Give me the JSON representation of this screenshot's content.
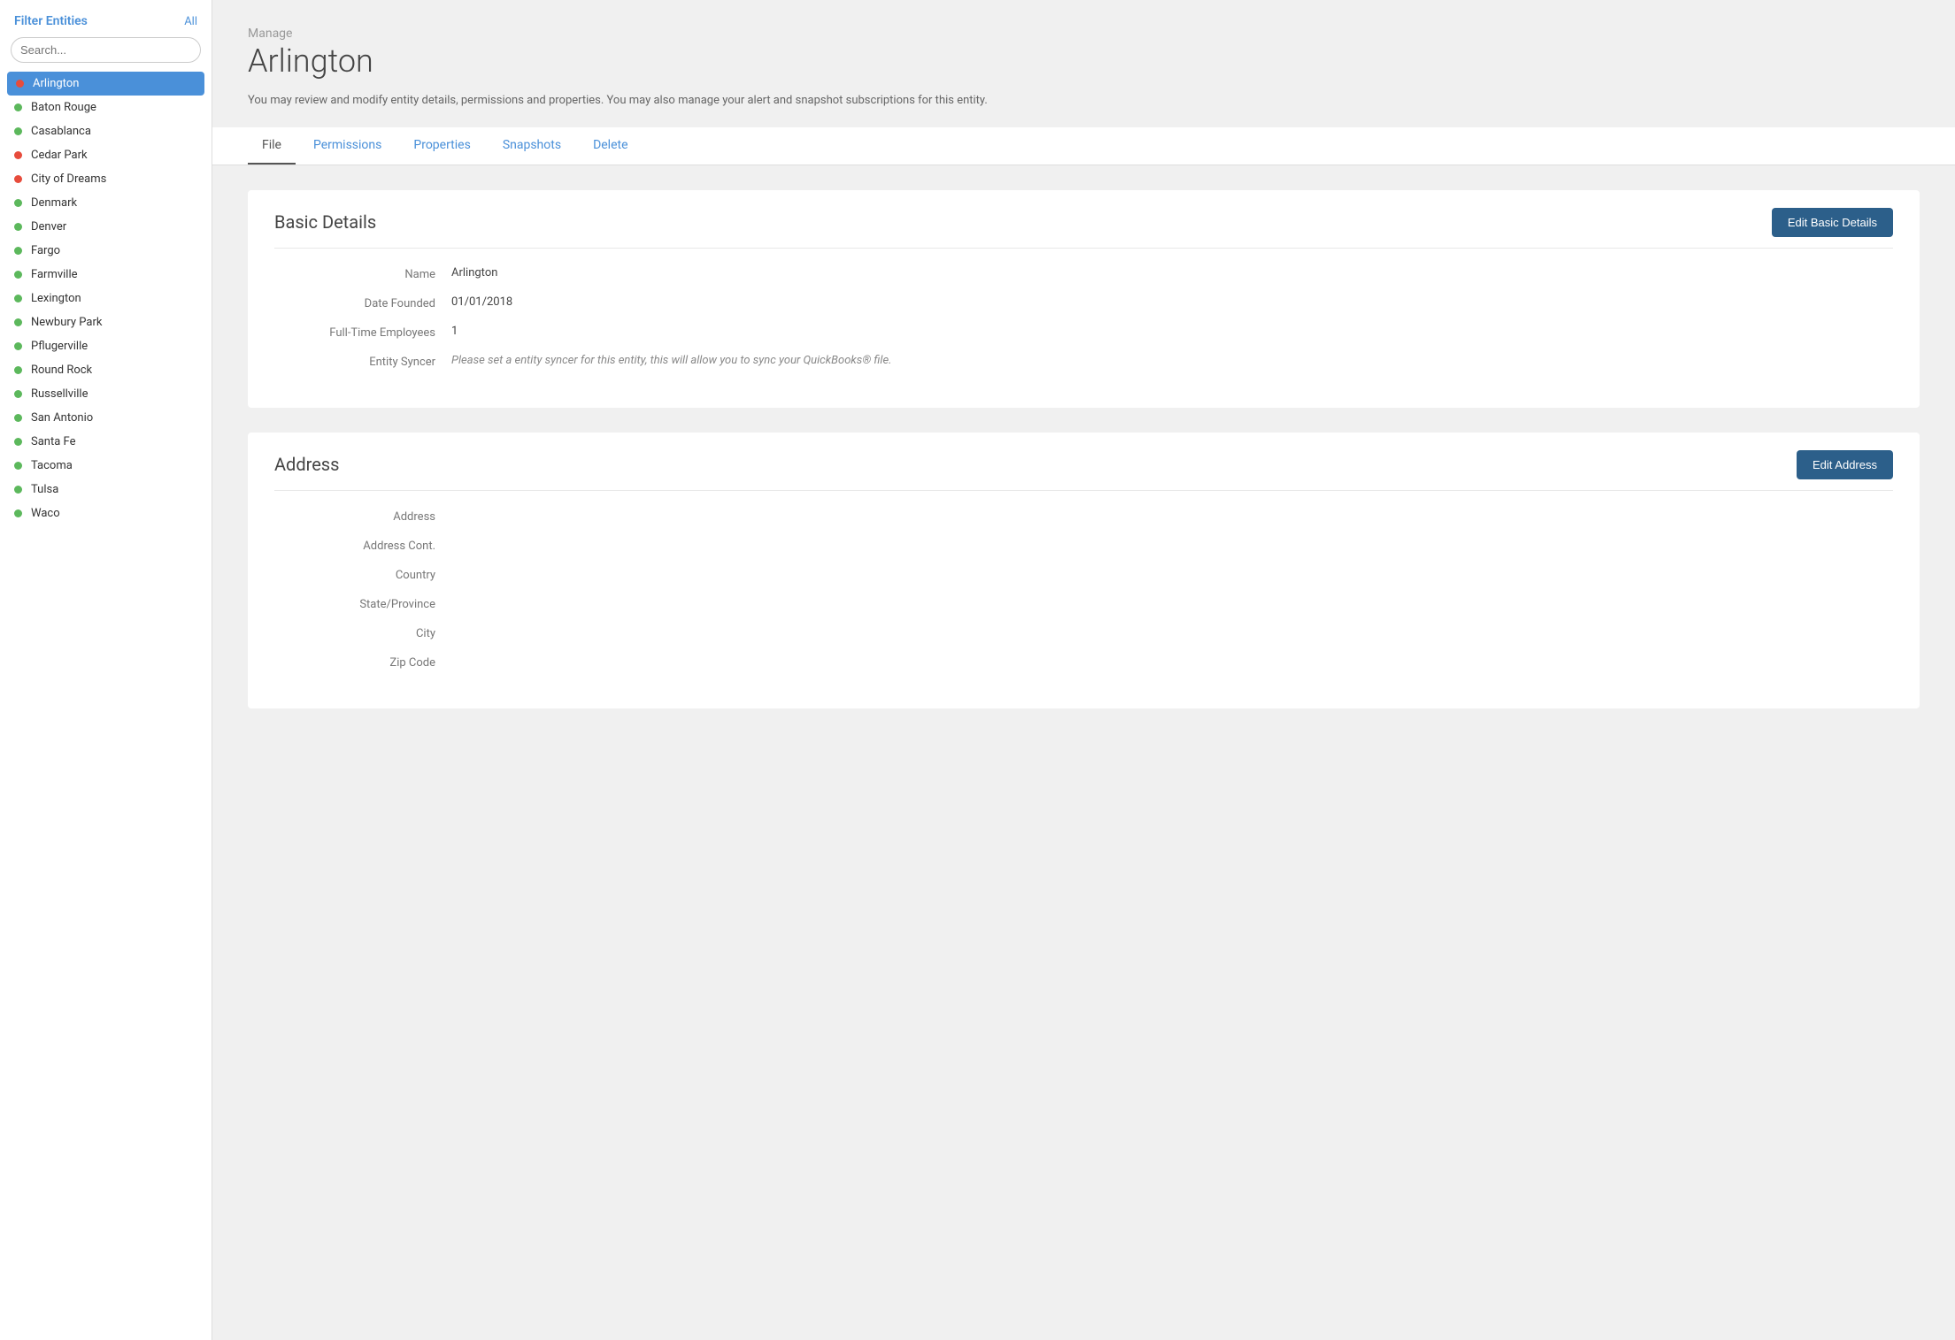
{
  "sidebar": {
    "filter_label": "Filter Entities",
    "all_label": "All",
    "search_placeholder": "Search...",
    "entities": [
      {
        "name": "Arlington",
        "dot": "red",
        "active": true
      },
      {
        "name": "Baton Rouge",
        "dot": "green",
        "active": false
      },
      {
        "name": "Casablanca",
        "dot": "green",
        "active": false
      },
      {
        "name": "Cedar Park",
        "dot": "red",
        "active": false
      },
      {
        "name": "City of Dreams",
        "dot": "red",
        "active": false
      },
      {
        "name": "Denmark",
        "dot": "green",
        "active": false
      },
      {
        "name": "Denver",
        "dot": "green",
        "active": false
      },
      {
        "name": "Fargo",
        "dot": "green",
        "active": false
      },
      {
        "name": "Farmville",
        "dot": "green",
        "active": false
      },
      {
        "name": "Lexington",
        "dot": "green",
        "active": false
      },
      {
        "name": "Newbury Park",
        "dot": "green",
        "active": false
      },
      {
        "name": "Pflugerville",
        "dot": "green",
        "active": false
      },
      {
        "name": "Round Rock",
        "dot": "green",
        "active": false
      },
      {
        "name": "Russellville",
        "dot": "green",
        "active": false
      },
      {
        "name": "San Antonio",
        "dot": "green",
        "active": false
      },
      {
        "name": "Santa Fe",
        "dot": "green",
        "active": false
      },
      {
        "name": "Tacoma",
        "dot": "green",
        "active": false
      },
      {
        "name": "Tulsa",
        "dot": "green",
        "active": false
      },
      {
        "name": "Waco",
        "dot": "green",
        "active": false
      }
    ]
  },
  "header": {
    "subtitle": "Manage",
    "title": "Arlington",
    "description": "You may review and modify entity details, permissions and properties. You may also manage your alert and snapshot subscriptions for this entity."
  },
  "tabs": [
    {
      "label": "File",
      "active": true
    },
    {
      "label": "Permissions",
      "active": false
    },
    {
      "label": "Properties",
      "active": false
    },
    {
      "label": "Snapshots",
      "active": false
    },
    {
      "label": "Delete",
      "active": false
    }
  ],
  "basic_details": {
    "title": "Basic Details",
    "edit_button": "Edit Basic Details",
    "fields": [
      {
        "label": "Name",
        "value": "Arlington",
        "muted": false
      },
      {
        "label": "Date Founded",
        "value": "01/01/2018",
        "muted": false
      },
      {
        "label": "Full-Time Employees",
        "value": "1",
        "muted": false
      },
      {
        "label": "Entity Syncer",
        "value": "Please set a entity syncer for this entity, this will allow you to sync your QuickBooks® file.",
        "muted": true
      }
    ]
  },
  "address": {
    "title": "Address",
    "edit_button": "Edit Address",
    "fields": [
      {
        "label": "Address",
        "value": "",
        "muted": false
      },
      {
        "label": "Address Cont.",
        "value": "",
        "muted": false
      },
      {
        "label": "Country",
        "value": "",
        "muted": false
      },
      {
        "label": "State/Province",
        "value": "",
        "muted": false
      },
      {
        "label": "City",
        "value": "",
        "muted": false
      },
      {
        "label": "Zip Code",
        "value": "",
        "muted": false
      }
    ]
  }
}
